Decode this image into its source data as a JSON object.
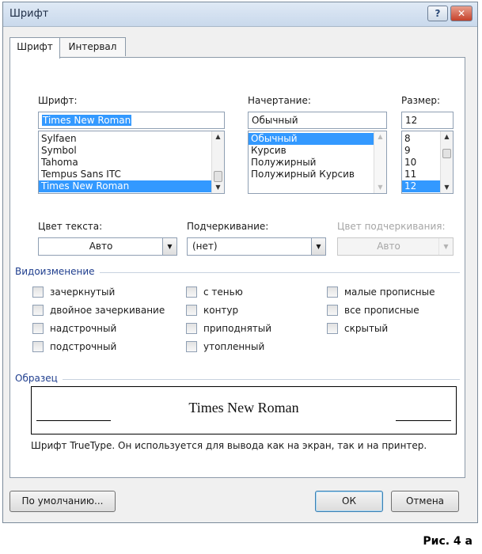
{
  "window": {
    "title": "Шрифт",
    "help_label": "?",
    "close_label": "✕"
  },
  "tabs": [
    {
      "label": "Шрифт",
      "active": true
    },
    {
      "label": "Интервал",
      "active": false
    }
  ],
  "font": {
    "label": "Шрифт:",
    "value": "Times New Roman",
    "items": [
      "Sylfaen",
      "Symbol",
      "Tahoma",
      "Tempus Sans ITC",
      "Times New Roman"
    ],
    "selected_index": 4
  },
  "style": {
    "label": "Начертание:",
    "value": "Обычный",
    "items": [
      "Обычный",
      "Курсив",
      "Полужирный",
      "Полужирный Курсив"
    ],
    "selected_index": 0
  },
  "size": {
    "label": "Размер:",
    "value": "12",
    "items": [
      "8",
      "9",
      "10",
      "11",
      "12"
    ],
    "selected_index": 4
  },
  "color": {
    "label": "Цвет текста:",
    "value": "Авто"
  },
  "underline": {
    "label": "Подчеркивание:",
    "value": "(нет)"
  },
  "underline_color": {
    "label": "Цвет подчеркивания:",
    "value": "Авто",
    "enabled": false
  },
  "effects": {
    "title": "Видоизменение",
    "col1": [
      "зачеркнутый",
      "двойное зачеркивание",
      "надстрочный",
      "подстрочный"
    ],
    "col2": [
      "с тенью",
      "контур",
      "приподнятый",
      "утопленный"
    ],
    "col3": [
      "малые прописные",
      "все прописные",
      "скрытый"
    ]
  },
  "preview": {
    "title": "Образец",
    "sample": "Times New Roman",
    "description": "Шрифт TrueType. Он используется для вывода как на экран, так и на принтер."
  },
  "buttons": {
    "default_label": "По умолчанию...",
    "ok_label": "ОК",
    "cancel_label": "Отмена"
  },
  "caption": "Рис. 4 а",
  "colors": {
    "selection": "#3399ff",
    "section_title": "#1f3e8e"
  }
}
